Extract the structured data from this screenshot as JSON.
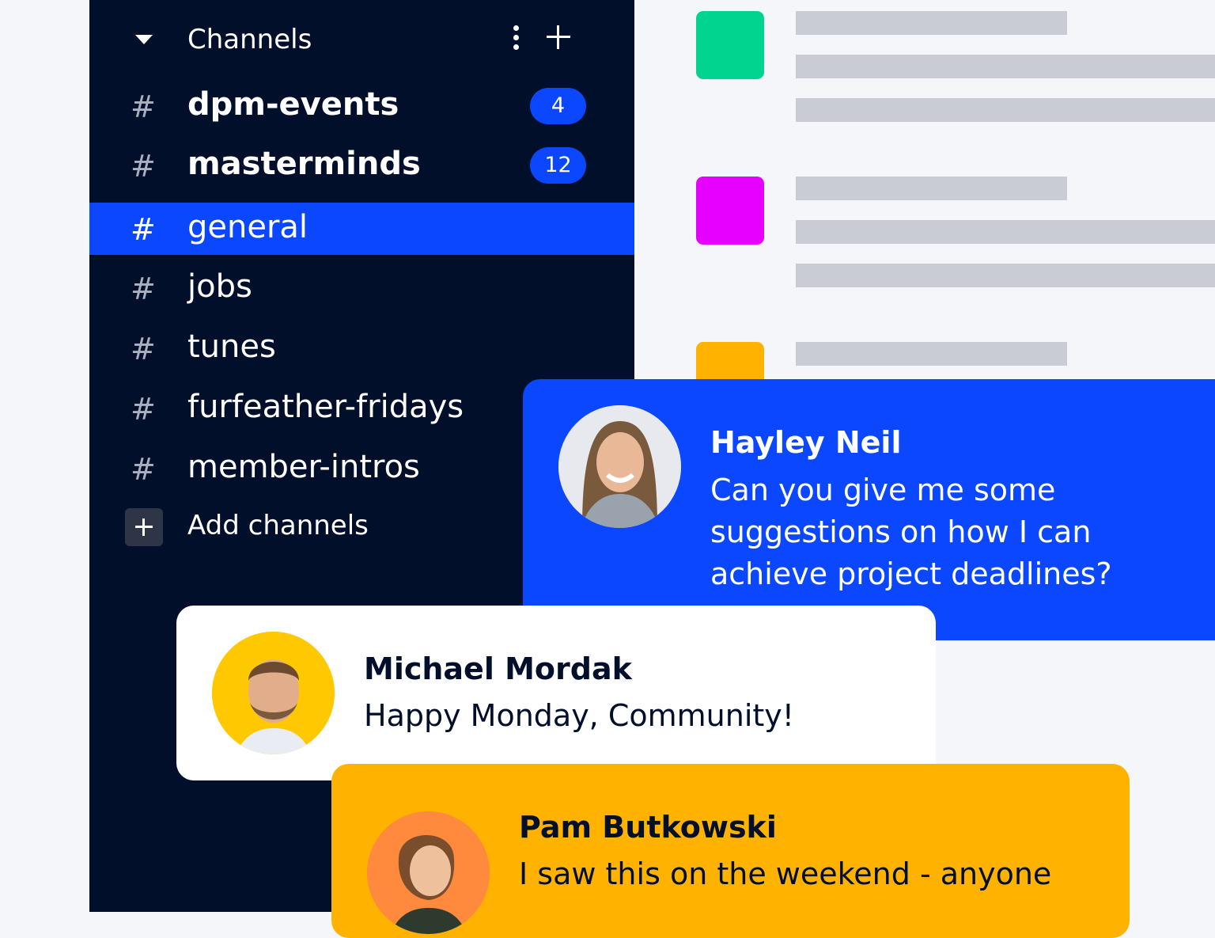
{
  "sidebar": {
    "header": {
      "title": "Channels"
    },
    "channels": [
      {
        "name": "dpm-events",
        "unread": "4",
        "bold": true,
        "active": false
      },
      {
        "name": "masterminds",
        "unread": "12",
        "bold": true,
        "active": false
      },
      {
        "name": "general",
        "active": true
      },
      {
        "name": "jobs"
      },
      {
        "name": "tunes"
      },
      {
        "name": "furfeather-fridays"
      },
      {
        "name": "member-intros"
      }
    ],
    "hash_symbol": "#",
    "add_channels_label": "Add channels"
  },
  "placeholders": {
    "square_colors": [
      "#00d48f",
      "#e600ff",
      "#ffb300"
    ],
    "bar_color": "#c9ccd4"
  },
  "messages": [
    {
      "author": "Hayley Neil",
      "lines": [
        "Can you give me some",
        "suggestions on how I can",
        "achieve project deadlines?"
      ],
      "card_color": "#0a47ff",
      "avatar_bg": "#e7e9ef"
    },
    {
      "author": "Michael Mordak",
      "lines": [
        "Happy Monday, Community!"
      ],
      "card_color": "#ffffff",
      "avatar_bg": "#ffc800"
    },
    {
      "author": "Pam Butkowski",
      "lines": [
        "I saw this on the weekend - anyone"
      ],
      "card_color": "#ffb300",
      "avatar_bg": "#ff8a3d"
    }
  ],
  "colors": {
    "sidebar_bg": "#020f2b",
    "accent": "#0a47ff",
    "page_bg": "#f5f6f9"
  }
}
